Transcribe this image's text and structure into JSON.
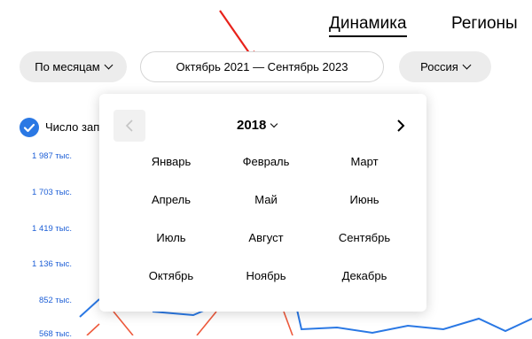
{
  "tabs": {
    "dynamics": "Динамика",
    "regions": "Регионы"
  },
  "filters": {
    "period_mode": "По месяцам",
    "date_range": "Октябрь 2021 — Сентябрь 2023",
    "region": "Россия"
  },
  "chart": {
    "legend_label": "Число запросов",
    "y_ticks": [
      "1 987 тыс.",
      "1 703 тыс.",
      "1 419 тыс.",
      "1 136 тыс.",
      "852 тыс.",
      "568 тыс."
    ],
    "colors": {
      "series_blue": "#2a78e4",
      "series_red": "#ee5a3c",
      "annotation_arrow": "#e8221b"
    }
  },
  "calendar": {
    "year": "2018",
    "months": [
      "Январь",
      "Февраль",
      "Март",
      "Апрель",
      "Май",
      "Июнь",
      "Июль",
      "Август",
      "Сентябрь",
      "Октябрь",
      "Ноябрь",
      "Декабрь"
    ]
  }
}
